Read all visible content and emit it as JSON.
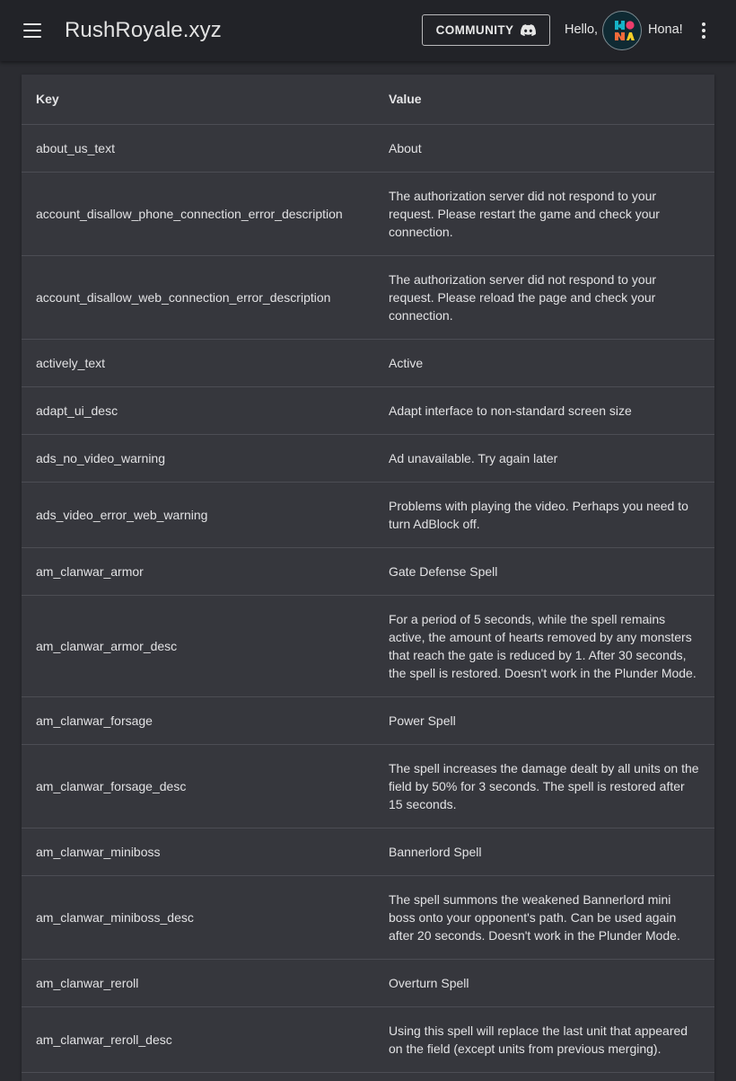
{
  "header": {
    "menu_icon": "hamburger-menu-icon",
    "title": "RushRoyale.xyz",
    "community_label": "COMMUNITY",
    "community_icon": "discord-icon",
    "greeting": "Hello,",
    "username": "Hona!",
    "more_icon": "more-vert-icon"
  },
  "colors": {
    "appbar": "#222328",
    "background": "#2b2c31",
    "card": "#36373d",
    "divider": "#4c4d54"
  },
  "table": {
    "columns": [
      "Key",
      "Value"
    ],
    "rows": [
      {
        "key": "about_us_text",
        "value": "About"
      },
      {
        "key": "account_disallow_phone_connection_error_description",
        "value": "The authorization server did not respond to your request. Please restart the game and check your connection."
      },
      {
        "key": "account_disallow_web_connection_error_description",
        "value": "The authorization server did not respond to your request. Please reload the page and check your connection."
      },
      {
        "key": "actively_text",
        "value": "Active"
      },
      {
        "key": "adapt_ui_desc",
        "value": "Adapt interface to non-standard screen size"
      },
      {
        "key": "ads_no_video_warning",
        "value": "Ad unavailable. Try again later"
      },
      {
        "key": "ads_video_error_web_warning",
        "value": "Problems with playing the video. Perhaps you need to turn AdBlock off."
      },
      {
        "key": "am_clanwar_armor",
        "value": "Gate Defense Spell"
      },
      {
        "key": "am_clanwar_armor_desc",
        "value": "For a period of 5 seconds, while the spell remains active, the amount of hearts removed by any monsters that reach the gate is reduced by 1. After 30 seconds, the spell is restored. Doesn't work in the Plunder Mode."
      },
      {
        "key": "am_clanwar_forsage",
        "value": "Power Spell"
      },
      {
        "key": "am_clanwar_forsage_desc",
        "value": "The spell increases the damage dealt by all units on the field by 50% for 3 seconds. The spell is restored after 15 seconds."
      },
      {
        "key": "am_clanwar_miniboss",
        "value": "Bannerlord Spell"
      },
      {
        "key": "am_clanwar_miniboss_desc",
        "value": "The spell summons the weakened Bannerlord mini boss onto your opponent's path. Can be used again after 20 seconds. Doesn't work in the Plunder Mode."
      },
      {
        "key": "am_clanwar_reroll",
        "value": "Overturn Spell"
      },
      {
        "key": "am_clanwar_reroll_desc",
        "value": "Using this spell will replace the last unit that appeared on the field (except units from previous merging)."
      }
    ]
  }
}
